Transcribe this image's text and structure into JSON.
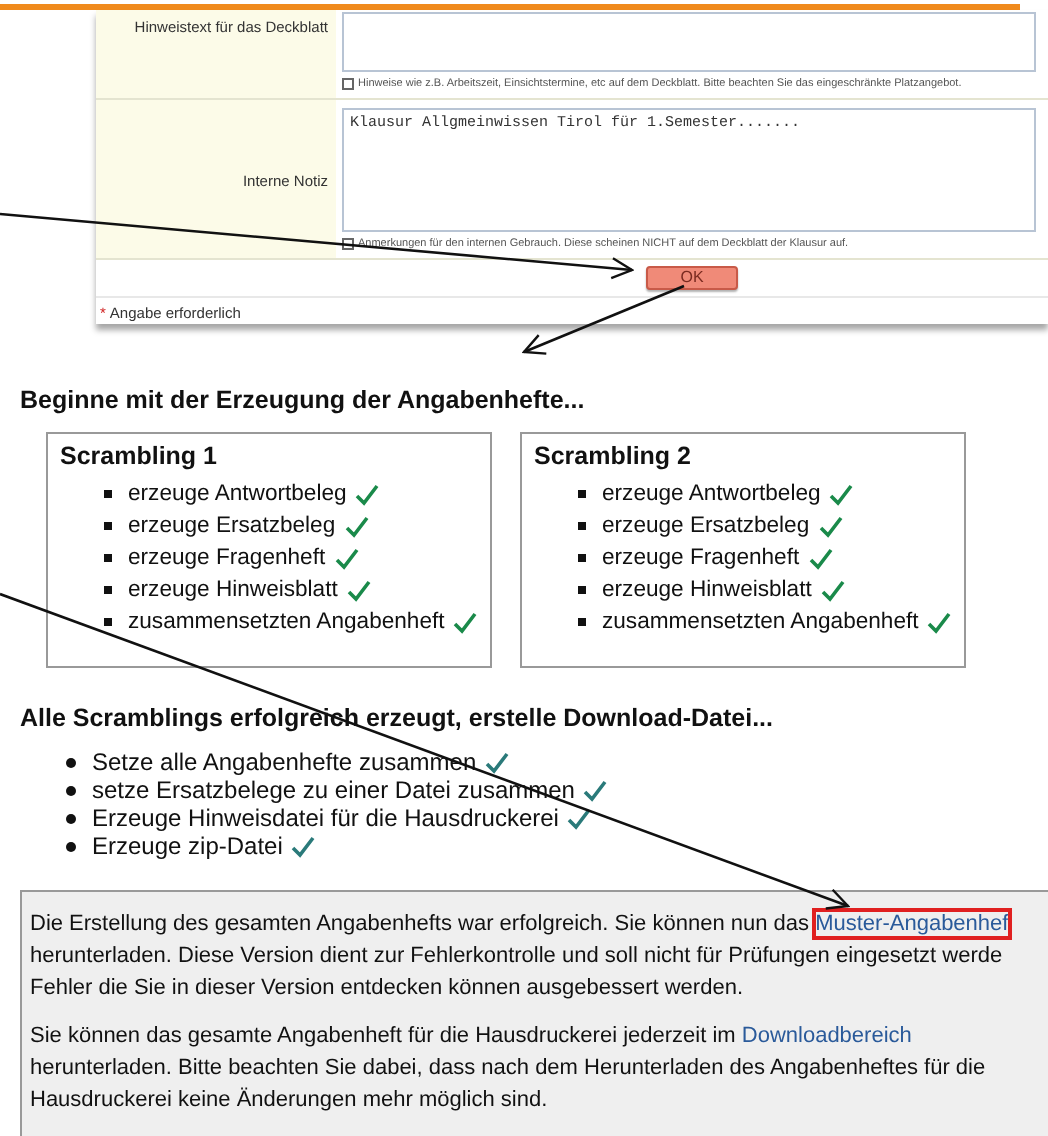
{
  "form": {
    "rows": [
      {
        "label": "Hinweistext für das Deckblatt",
        "value": "",
        "hint": "Hinweise wie z.B. Arbeitszeit, Einsichtstermine, etc auf dem Deckblatt. Bitte beachten Sie das eingeschränkte Platzangebot.",
        "tall": false
      },
      {
        "label": "Interne Notiz",
        "value": "Klausur Allgmeinwissen Tirol für 1.Semester.......",
        "hint": "Anmerkungen für den internen Gebrauch. Diese scheinen NICHT auf dem Deckblatt der Klausur auf.",
        "tall": true
      }
    ],
    "submit": "OK",
    "required_mark": "*",
    "required_note": "Angabe erforderlich"
  },
  "section1": {
    "heading": "Beginne mit der Erzeugung der Angabenhefte...",
    "scramblings": [
      {
        "title": "Scrambling 1",
        "steps": [
          {
            "text": "erzeuge Antwortbeleg",
            "done": true
          },
          {
            "text": "erzeuge Ersatzbeleg",
            "done": true
          },
          {
            "text": "erzeuge Fragenheft",
            "done": true
          },
          {
            "text": "erzeuge Hinweisblatt",
            "done": true
          },
          {
            "text": "zusammensetzten Angabenheft",
            "done": true
          }
        ]
      },
      {
        "title": "Scrambling 2",
        "steps": [
          {
            "text": "erzeuge Antwortbeleg",
            "done": true
          },
          {
            "text": "erzeuge Ersatzbeleg",
            "done": true
          },
          {
            "text": "erzeuge Fragenheft",
            "done": true
          },
          {
            "text": "erzeuge Hinweisblatt",
            "done": true
          },
          {
            "text": "zusammensetzten Angabenheft",
            "done": true
          }
        ]
      }
    ]
  },
  "section2": {
    "heading": "Alle Scramblings erfolgreich erzeugt, erstelle Download-Datei...",
    "steps": [
      {
        "text": "Setze alle Angabenhefte zusammen",
        "done": true
      },
      {
        "text": "setze Ersatzbelege zu einer Datei zusammen",
        "done": true
      },
      {
        "text": "Erzeuge Hinweisdatei für die Hausdruckerei",
        "done": true
      },
      {
        "text": "Erzeuge zip-Datei",
        "done": true
      }
    ]
  },
  "result": {
    "paragraphs": [
      [
        {
          "kind": "text",
          "text": "Die Erstellung des gesamten Angabenhefts war erfolgreich. Sie können nun das "
        },
        {
          "kind": "link",
          "text": "Muster-Angabenhef",
          "highlighted": true
        },
        {
          "kind": "text",
          "text": "\nherunterladen. Diese Version dient zur Fehlerkontrolle und soll nicht für Prüfungen eingesetzt werde\nFehler die Sie in dieser Version entdecken können ausgebessert werden."
        }
      ],
      [
        {
          "kind": "text",
          "text": "Sie können das gesamte Angabenheft für die Hausdruckerei jederzeit im "
        },
        {
          "kind": "link",
          "text": "Downloadbereich",
          "highlighted": false
        },
        {
          "kind": "text",
          "text": "\nherunterladen. Bitte beachten Sie dabei, dass nach dem Herunterladen des Angabenheftes für die\nHausdruckerei keine Änderungen mehr möglich sind."
        }
      ]
    ]
  }
}
